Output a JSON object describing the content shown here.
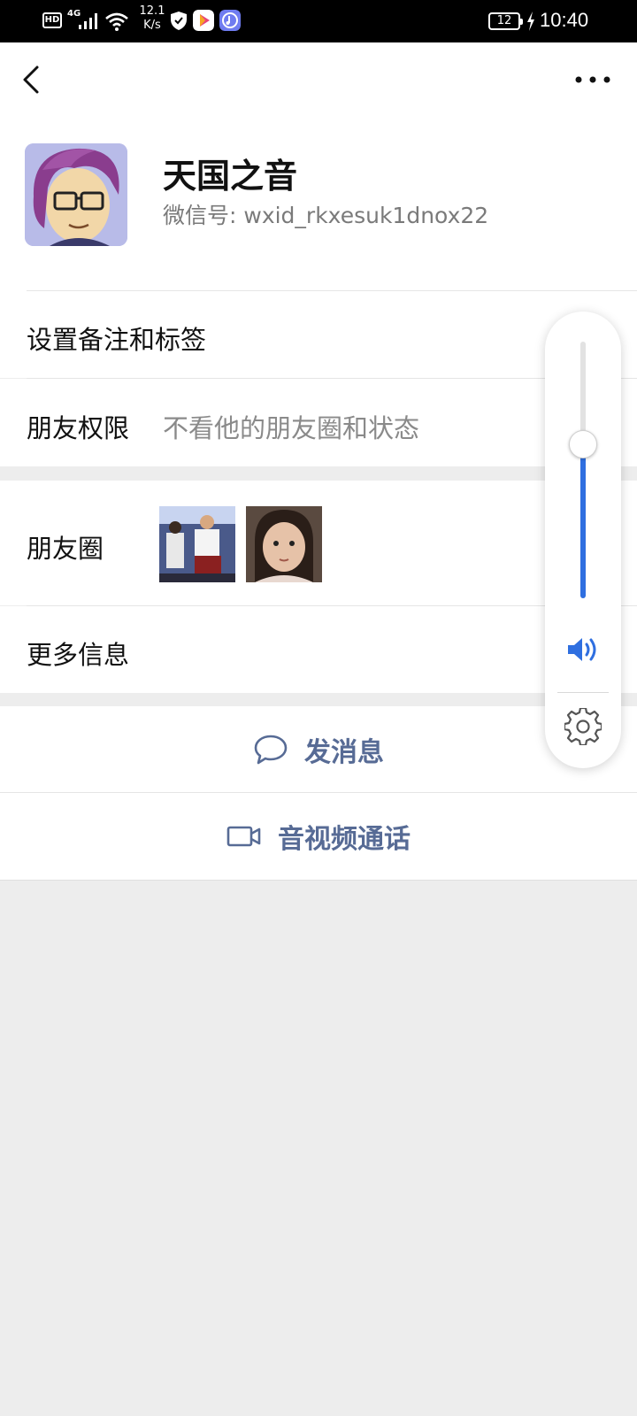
{
  "status_bar": {
    "hd": "HD",
    "network": "4G",
    "speed_value": "12.1",
    "speed_unit": "K/s",
    "battery": "12",
    "time": "10:40",
    "icons": [
      "hd-icon",
      "signal-icon",
      "wifi-icon",
      "shield-icon",
      "video-app-icon",
      "music-app-icon",
      "charging-icon"
    ]
  },
  "nav": {
    "back_icon": "chevron-left-icon",
    "more_icon": "more-dots-icon"
  },
  "profile": {
    "name": "天国之音",
    "wechat_id": "微信号: wxid_rkxesuk1dnox22",
    "avatar": "cartoon-avatar-glasses"
  },
  "rows": {
    "remark": {
      "label": "设置备注和标签"
    },
    "permission": {
      "label": "朋友权限",
      "value": "不看他的朋友圈和状态"
    },
    "moments": {
      "label": "朋友圈",
      "thumbnails": [
        "moment-photo-1",
        "moment-photo-2"
      ]
    },
    "more_info": {
      "label": "更多信息"
    }
  },
  "actions": {
    "message": {
      "label": "发消息",
      "icon": "chat-bubble-icon"
    },
    "call": {
      "label": "音视频通话",
      "icon": "video-camera-icon"
    }
  },
  "volume_panel": {
    "level": 0.6,
    "speaker_icon": "speaker-icon",
    "settings_icon": "gear-icon"
  },
  "colors": {
    "link_blue": "#576b95",
    "volume_blue": "#2f6fe0",
    "background_gray": "#ededed"
  }
}
